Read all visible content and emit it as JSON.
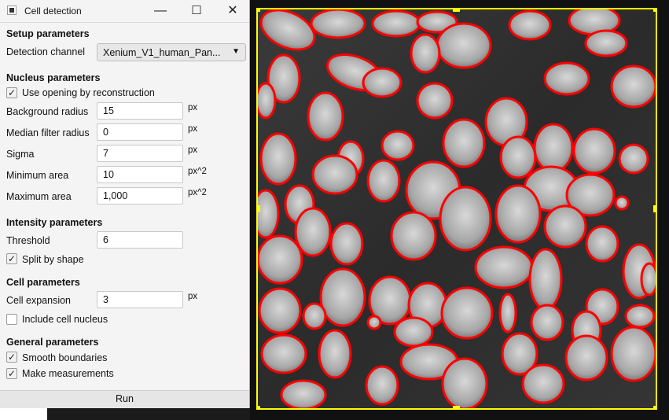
{
  "window": {
    "title": "Cell detection",
    "controls": {
      "minimize": "—",
      "maximize": "☐",
      "close": "✕"
    }
  },
  "setup": {
    "heading": "Setup parameters",
    "detection_channel_label": "Detection channel",
    "detection_channel_value": "Xenium_V1_human_Pan..."
  },
  "nucleus": {
    "heading": "Nucleus parameters",
    "use_opening_label": "Use opening by reconstruction",
    "use_opening_checked": true,
    "background_radius_label": "Background radius",
    "background_radius_value": "15",
    "background_radius_unit": "px",
    "median_filter_label": "Median filter radius",
    "median_filter_value": "0",
    "median_filter_unit": "px",
    "sigma_label": "Sigma",
    "sigma_value": "7",
    "sigma_unit": "px",
    "min_area_label": "Minimum area",
    "min_area_value": "10",
    "min_area_unit": "px^2",
    "max_area_label": "Maximum area",
    "max_area_value": "1,000",
    "max_area_unit": "px^2"
  },
  "intensity": {
    "heading": "Intensity parameters",
    "threshold_label": "Threshold",
    "threshold_value": "6",
    "split_label": "Split by shape",
    "split_checked": true
  },
  "cell": {
    "heading": "Cell parameters",
    "expansion_label": "Cell expansion",
    "expansion_value": "3",
    "expansion_unit": "px",
    "include_nucleus_label": "Include cell nucleus",
    "include_nucleus_checked": false
  },
  "general": {
    "heading": "General parameters",
    "smooth_label": "Smooth boundaries",
    "smooth_checked": true,
    "measure_label": "Make measurements",
    "measure_checked": true
  },
  "run_label": "Run",
  "colors": {
    "detection_outline": "#ff0000",
    "selection_box": "#ffff00",
    "accent_border": "#7fb1c9"
  }
}
